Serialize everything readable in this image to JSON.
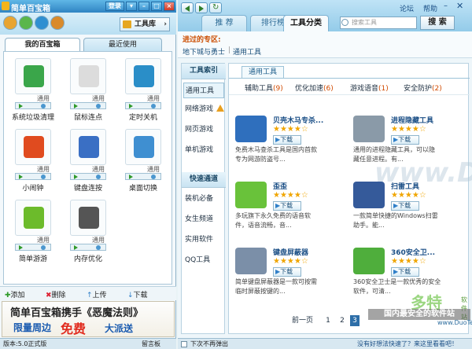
{
  "left": {
    "title": "简单百宝箱",
    "login": "登录",
    "tools_label": "工具库",
    "tabs": [
      "我的百宝箱",
      "最近使用"
    ],
    "apps": [
      {
        "name": "系统垃圾清理",
        "tag": "通用",
        "color": "#3aa64a"
      },
      {
        "name": "鼠标连点",
        "tag": "通用",
        "color": "#dcdcdc"
      },
      {
        "name": "定时关机",
        "tag": "通用",
        "color": "#2a8ec8"
      },
      {
        "name": "小闹钟",
        "tag": "通用",
        "color": "#e04b1f"
      },
      {
        "name": "键盘连按",
        "tag": "通用",
        "color": "#3a6fc4"
      },
      {
        "name": "桌面切换",
        "tag": "通用",
        "color": "#3f8fd1"
      },
      {
        "name": "简单游游",
        "tag": "通用",
        "color": "#6cbb2b"
      },
      {
        "name": "内存优化",
        "tag": "通用",
        "color": "#555555"
      }
    ],
    "actions": [
      "添加",
      "删除",
      "上传",
      "下载"
    ],
    "banner": {
      "line1": "简单百宝箱携手《恶魔法则》",
      "line2": "限量周边",
      "line3": "免费",
      "line4": "大派送"
    },
    "status_version": "版本:5.0正式版",
    "status_board": "留言板"
  },
  "right": {
    "top_links": [
      "论坛",
      "帮助"
    ],
    "tabs": [
      "推  荐",
      "排行榜",
      "工具分类"
    ],
    "search_placeholder": "搜索工具",
    "search_button": "搜  索",
    "visited_title": "进过的专区:",
    "visited_items": [
      "地下城与勇士",
      "通用工具"
    ],
    "side_index_title": "工具索引",
    "side_index": [
      "通用工具",
      "网络游戏",
      "网页游戏",
      "单机游戏"
    ],
    "side_quick_title": "快速通道",
    "side_quick": [
      "装机必备",
      "女生频道",
      "实用软件",
      "QQ工具"
    ],
    "content_tab": "通用工具",
    "subcats": [
      {
        "label": "辅助工具",
        "count": "(9)"
      },
      {
        "label": "优化加速",
        "count": "(6)"
      },
      {
        "label": "游戏语音",
        "count": "(1)"
      },
      {
        "label": "安全防护",
        "count": "(2)"
      }
    ],
    "download_label": "下载",
    "cards": [
      {
        "title": "贝壳木马专杀...",
        "stars": "★★★★☆",
        "d1": "免费木马查杀工具是国内首款",
        "d2": "专为网游防盗号...",
        "color": "#2f6fbd"
      },
      {
        "title": "进程隐藏工具",
        "stars": "★★★★☆",
        "d1": "通用的进程隐藏工具，可以隐",
        "d2": "藏任意进程。有...",
        "color": "#8a9aa8"
      },
      {
        "title": "歪歪",
        "stars": "★★★★☆",
        "d1": "多玩旗下永久免费的语音软",
        "d2": "件，语音流畅，音...",
        "color": "#69c23a"
      },
      {
        "title": "扫雷工具",
        "stars": "★★★★☆",
        "d1": "一款简单快捷的Windows扫雷",
        "d2": "助手。能...",
        "color": "#355a9a"
      },
      {
        "title": "键盘屏蔽器",
        "stars": "★★★★☆",
        "d1": "简单键盘屏蔽器是一款可按需",
        "d2": "临时屏蔽按键的...",
        "color": "#7b8fa8"
      },
      {
        "title": "360安全卫...",
        "stars": "★★★★☆",
        "d1": "360安全卫士是一款优秀的安全",
        "d2": "软件，可清...",
        "color": "#4fae3c"
      }
    ],
    "pager": {
      "prev": "前一页",
      "pages": [
        "1",
        "2",
        "3"
      ]
    },
    "status_left": "下次不再弹出",
    "status_right": "没有好想法快速了？来这里看看吧！",
    "watermark_center": "www.DuoTe.com",
    "watermark_brand": "多特",
    "watermark_brand_sub": "软件站",
    "watermark_slogan": "国内最安全的软件站",
    "watermark_url": "www.DuoTe.com"
  }
}
